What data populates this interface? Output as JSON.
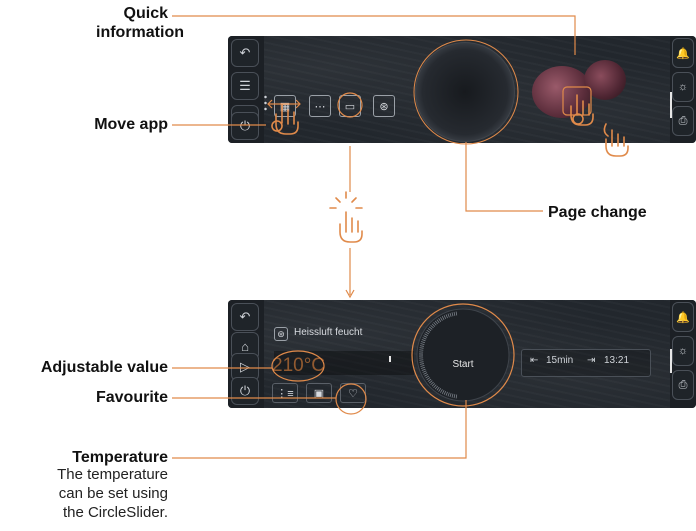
{
  "callouts": {
    "quick_information": "Quick\ninformation",
    "move_app": "Move app",
    "page_change": "Page change",
    "adjustable_value": "Adjustable value",
    "favourite": "Favourite",
    "temperature": "Temperature",
    "temperature_desc": "The temperature\ncan be set using\nthe CircleSlider."
  },
  "screen2": {
    "mode_label": "Heissluft feucht",
    "temperature_value": "210°C",
    "start_label": "Start",
    "duration_value": "15min",
    "end_time_value": "13:21"
  },
  "icons": {
    "back": "↶",
    "home": "⌂",
    "list": "☰",
    "play": "▷",
    "power": "⏻",
    "bell": "🔔",
    "light": "☼",
    "tray": "⎙",
    "steam": "≋",
    "duration": "⇤",
    "end_time": "⇥",
    "heart": "♡",
    "fan": "⊛"
  },
  "colors": {
    "accent": "#e08a4a",
    "panel_bg": "#22272d",
    "line": "#e08a4a"
  }
}
